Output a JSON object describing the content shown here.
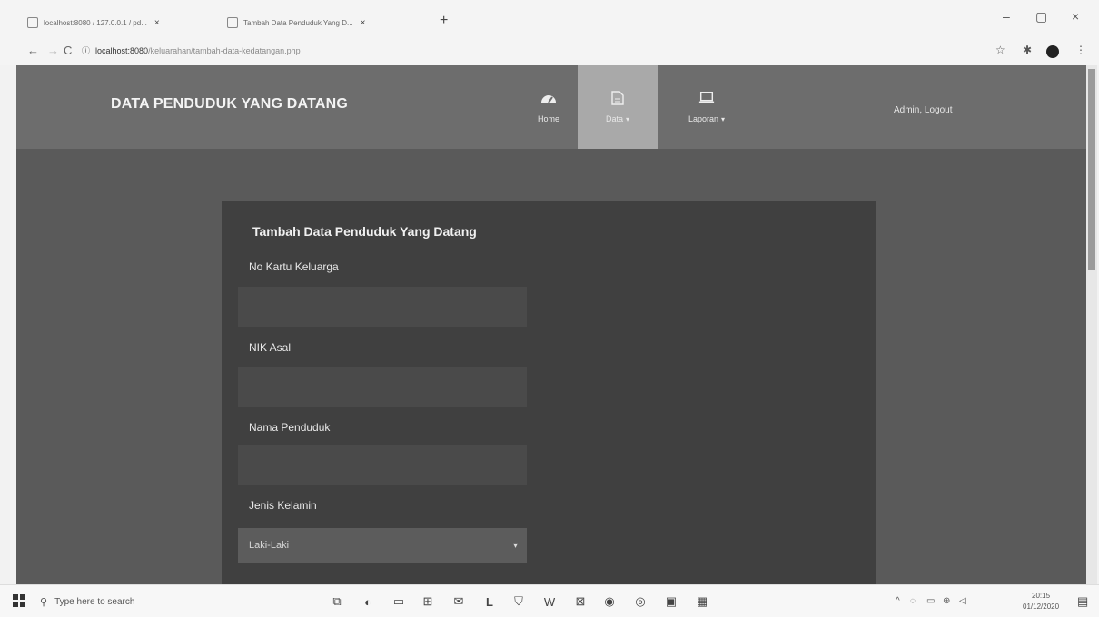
{
  "browser": {
    "tabs": [
      {
        "title": "localhost:8080 / 127.0.0.1 / pd...",
        "close": "×"
      },
      {
        "title": "Tambah Data Penduduk Yang D...",
        "close": "×"
      }
    ],
    "new_tab": "+",
    "window_controls": {
      "minimize": "–",
      "restore": "▢",
      "close": "×"
    },
    "nav": {
      "back": "←",
      "forward": "→",
      "reload": "C",
      "info": "ⓘ"
    },
    "url_host": "localhost:8080",
    "url_path": "/keluarahan/tambah-data-kedatangan.php",
    "toolbar_icons": {
      "star": "☆",
      "puzzle": "✱"
    }
  },
  "app": {
    "brand": "DATA PENDUDUK YANG DATANG",
    "nav": [
      {
        "label": "Home",
        "icon": "dashboard-icon",
        "caret": ""
      },
      {
        "label": "Data",
        "icon": "file-icon",
        "caret": "▾"
      },
      {
        "label": "Laporan",
        "icon": "laptop-icon",
        "caret": "▾"
      }
    ],
    "user_link": "Admin, Logout",
    "accent_colors": {
      "navbar": "#6d6d6d",
      "active_nav": "#a9a9a9",
      "card": "#404040"
    }
  },
  "form": {
    "title": "Tambah Data Penduduk Yang Datang",
    "fields": [
      {
        "label": "No Kartu Keluarga",
        "value": ""
      },
      {
        "label": "NIK Asal",
        "value": ""
      },
      {
        "label": "Nama Penduduk",
        "value": ""
      },
      {
        "label": "Jenis Kelamin",
        "selected": "Laki-Laki"
      }
    ]
  },
  "taskbar": {
    "search_placeholder": "Type here to search",
    "clock_time": "20:15",
    "clock_date": "01/12/2020",
    "letter_app": "L"
  }
}
